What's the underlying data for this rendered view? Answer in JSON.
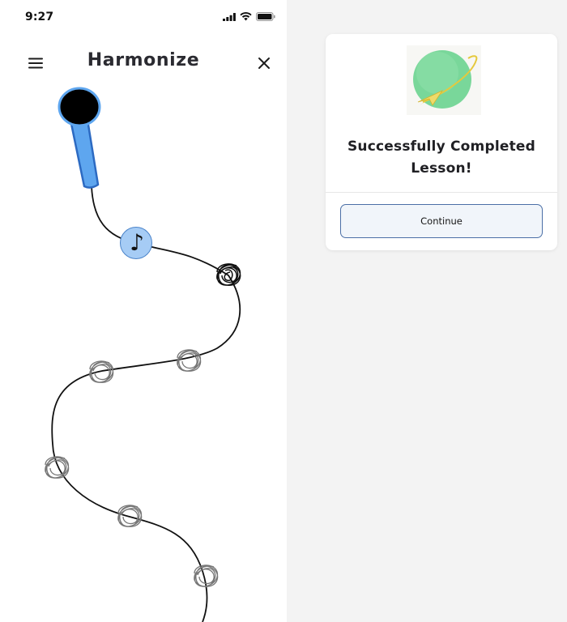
{
  "status_bar": {
    "time": "9:27",
    "icons": [
      "signal-icon",
      "wifi-icon",
      "battery-icon"
    ]
  },
  "header": {
    "title": "Harmonize",
    "menu_icon": "hamburger-menu-icon",
    "close_icon": "close-icon"
  },
  "lesson_path": {
    "current_node_icon": "music-note-icon",
    "current_node_glyph": "♪",
    "completed_node_icon": "scribble-node-icon",
    "locked_node_icon": "faded-scribble-node-icon",
    "microphone_icon": "microphone-icon",
    "locked_node_count": 6
  },
  "dialog": {
    "icon": "planet-paper-plane-icon",
    "title": "Successfully Completed Lesson!",
    "continue_label": "Continue"
  },
  "colors": {
    "background": "#f3f3f3",
    "surface": "#ffffff",
    "microphone_fill": "#5ea6ef",
    "microphone_stroke": "#2c6ac2",
    "note_fill": "#a6ccf5",
    "button_border": "#4b6fa6",
    "planet_green": "#79d79a",
    "plane_yellow": "#e5c93d"
  }
}
